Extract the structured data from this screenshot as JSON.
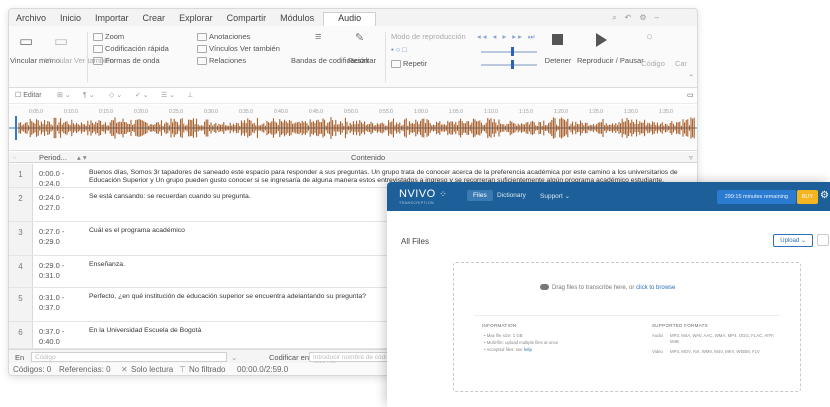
{
  "desktop": {
    "menu": [
      "Archivo",
      "Inicio",
      "Importar",
      "Crear",
      "Explorar",
      "Compartir",
      "Módulos",
      "Audio"
    ],
    "active_menu": "Audio",
    "ribbon": {
      "vincular_memo": "Vincular memo",
      "vincular_ver_tambien": "Vincular Ver también",
      "zoom": "Zoom",
      "codificacion_rapida": "Codificación rápida",
      "formas_de_onda": "Formas de onda",
      "anotaciones": "Anotaciones",
      "vinculos_ver_tambien": "Vínculos Ver también",
      "relaciones": "Relaciones",
      "bandas_codificacion": "Bandas de codificación",
      "resaltar": "Resaltar",
      "modo_reproduccion": "Modo de reproducción",
      "repetir": "Repetir",
      "detener": "Detener",
      "reproducir_pausar": "Reproducir / Pausar",
      "codigo": "Código",
      "car": "Car"
    },
    "toolbar": {
      "editar": "Editar"
    },
    "table": {
      "col_period": "Period...",
      "col_content": "Contenido",
      "rows": [
        {
          "num": "1",
          "start": "0:00.0 -",
          "end": "0:24.0",
          "content": "Buenos días, Somos 3r tapadores de saneado este espacio para responder a sus preguntas. Un grupo trata de conocer acerca de la preferencia académica por este camino a los universitarios de Educación Superior y Un grupo pueden gusto conocer si se ingresaría de alguna manera estos entrevistados a ingreso y se recorreran suficientemente algún programa académico estudiante."
        },
        {
          "num": "2",
          "start": "0:24.0 -",
          "end": "0:27.0",
          "content": "Se está cansando: se recuerdan cuando su pregunta."
        },
        {
          "num": "3",
          "start": "0:27.0 -",
          "end": "0:29.0",
          "content": "Cuál es el programa académico"
        },
        {
          "num": "4",
          "start": "0:29.0 -",
          "end": "0:31.0",
          "content": "Enseñanza."
        },
        {
          "num": "5",
          "start": "0:31.0 -",
          "end": "0:37.0",
          "content": "Perfecto, ¿en qué institución de educación superior se encuentra adelantando su pregunta?"
        },
        {
          "num": "6",
          "start": "0:37.0 -",
          "end": "0:40.0",
          "content": "En la Universidad Escuela de Bogotá"
        }
      ]
    },
    "findbar": {
      "en": "En",
      "placeholder_en": "Código",
      "codificar_en": "Codificar en",
      "placeholder_codificar": "Introducir nombre de código (Ctrl+Q)"
    },
    "status": {
      "codigos": "Códigos: 0",
      "referencias": "Referencias: 0",
      "solo_lectura": "Solo lectura",
      "no_filtrado": "No filtrado",
      "time": "00:00.0/2:59.0"
    },
    "timeline_labels": [
      "0:05.0",
      "0:10.0",
      "0:15.0",
      "0:20.0",
      "0:25.0",
      "0:30.0",
      "0:35.0",
      "0:40.0",
      "0:45.0",
      "0:50.0",
      "0:55.0",
      "1:00.0",
      "1:05.0",
      "1:10.0",
      "1:15.0",
      "1:20.0",
      "1:25.0",
      "1:30.0",
      "1:35.0"
    ],
    "colors": {
      "waveform": "#a0521a",
      "selection": "#3778c2"
    }
  },
  "web": {
    "logo": "NVIVO",
    "logo_sub": "TRANSCRIPTION",
    "nav": [
      "Files",
      "Dictionary",
      "Support ⌄"
    ],
    "active_nav": "Files",
    "minutes": "299:15 minutes remaining",
    "buy": "BUY",
    "title": "All Files",
    "upload": "Upload ⌄",
    "drop_text": "Drag files to transcribe here, or ",
    "drop_link": "click to browse",
    "info_title": "INFORMATION",
    "info_items": [
      "Max file size: 1 GB",
      "Multi-file: upload multiple files at once",
      "Accepted files: see "
    ],
    "info_link": "help",
    "formats_title": "SUPPORTED FORMATS",
    "formats_audio_label": "Audio",
    "formats_audio": "MP3, M4A, WAV, AAC, WMA, MP4, OGG, FLAC, AIFF, M4B",
    "formats_video_label": "Video",
    "formats_video": "MP4, MOV, AVI, WMV, M4V, MKV, WEBM, FLV"
  },
  "colors": {
    "web_nav": "#1d5f98",
    "accent_blue": "#2b7bd0",
    "buy_yellow": "#f5b520"
  }
}
